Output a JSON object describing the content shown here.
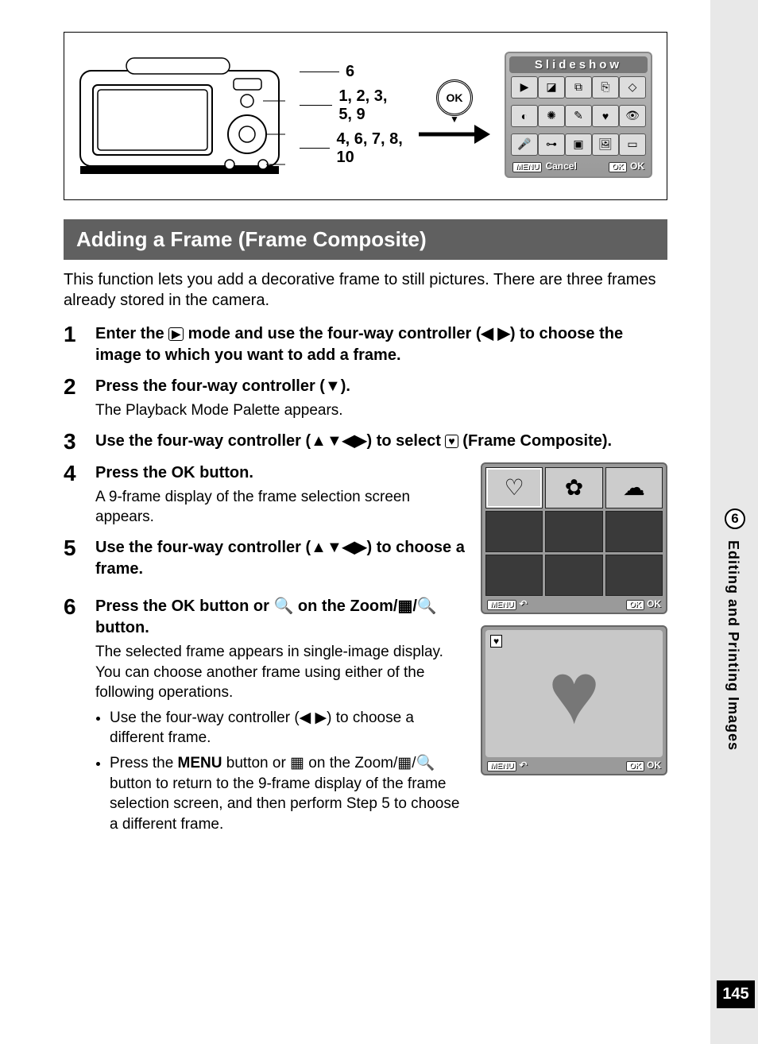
{
  "sidebar": {
    "chapter_number": "6",
    "chapter_title": "Editing and Printing Images",
    "page_number": "145"
  },
  "figure": {
    "callout1": "6",
    "callout2": "1, 2, 3, 5, 9",
    "callout3": "4, 6, 7, 8, 10",
    "ok_label": "OK",
    "lcd_title": "Slideshow",
    "lcd_menu": "MENU",
    "lcd_cancel": "Cancel",
    "lcd_ok_btn": "OK",
    "lcd_ok_text": "OK"
  },
  "section_heading": "Adding a Frame (Frame Composite)",
  "intro": "This function lets you add a decorative frame to still pictures. There are three frames already stored in the camera.",
  "steps": {
    "s1": {
      "num": "1",
      "title_a": "Enter the ",
      "title_b": " mode and use the four-way controller (◀ ▶) to choose the image to which you want to add a frame."
    },
    "s2": {
      "num": "2",
      "title": "Press the four-way controller (▼).",
      "desc": "The Playback Mode Palette appears."
    },
    "s3": {
      "num": "3",
      "title_a": "Use the four-way controller (▲▼◀▶) to select ",
      "title_b": " (Frame Composite)."
    },
    "s4": {
      "num": "4",
      "title_a": "Press the ",
      "ok": "OK",
      "title_b": " button.",
      "desc": "A 9-frame display of the frame selection screen appears."
    },
    "s5": {
      "num": "5",
      "title": "Use the four-way controller (▲▼◀▶) to choose a frame."
    },
    "s6": {
      "num": "6",
      "title_a": "Press the ",
      "ok": "OK",
      "title_b": " button or 🔍 on the Zoom/▦/🔍 button.",
      "desc1": "The selected frame appears in single-image display.",
      "desc2": "You can choose another frame using either of the following operations.",
      "bullet1": "Use the four-way controller (◀ ▶) to choose a different frame.",
      "bullet2_a": "Press the ",
      "bullet2_menu": "MENU",
      "bullet2_b": " button or ▦ on the Zoom/▦/🔍 button to return to the 9-frame display of the frame selection screen, and then perform Step 5 to choose a different frame."
    }
  },
  "mini": {
    "menu": "MENU",
    "back_glyph": "↶",
    "ok_btn": "OK",
    "ok_text": "OK"
  }
}
